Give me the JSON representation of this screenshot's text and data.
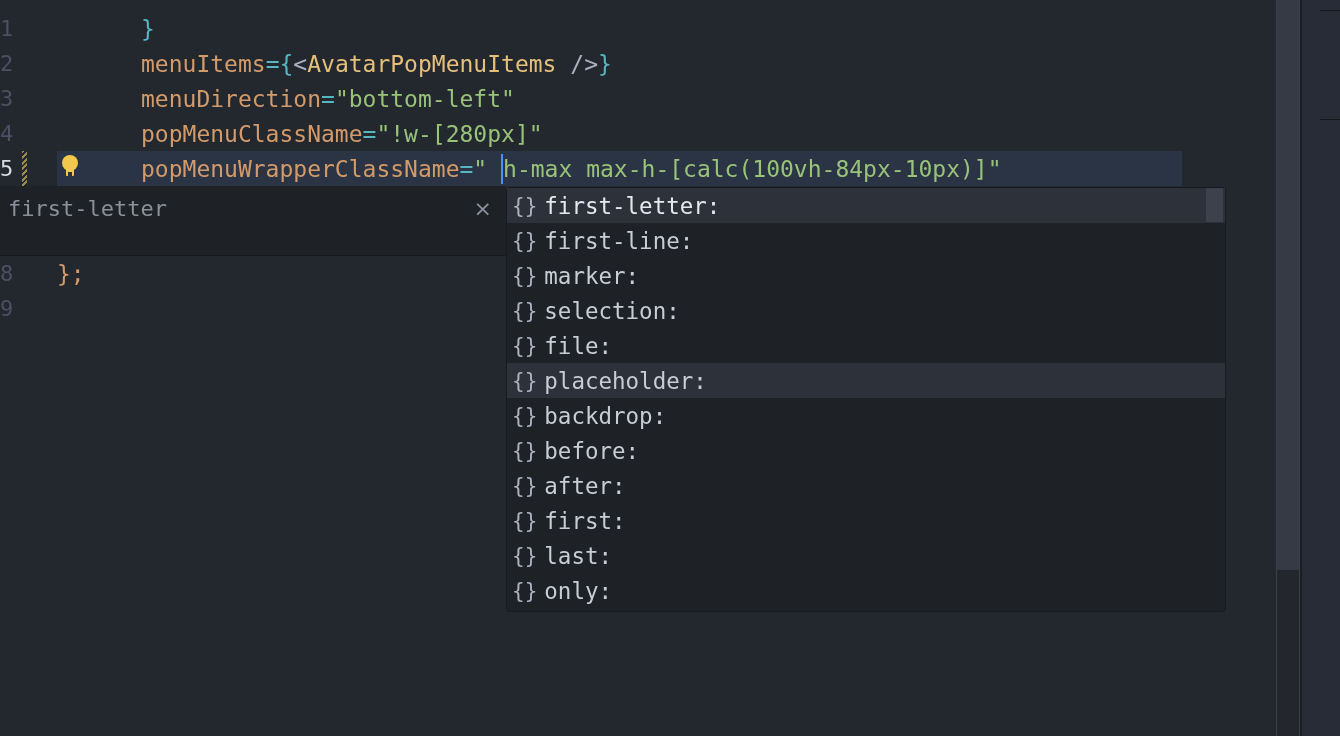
{
  "editor": {
    "lines": [
      {
        "number": "1",
        "current": false,
        "lightbulb": false,
        "modified": false,
        "indented": true,
        "tokens": [
          {
            "kind": "punct",
            "text": "}"
          }
        ]
      },
      {
        "number": "2",
        "current": false,
        "lightbulb": false,
        "modified": false,
        "indented": true,
        "tokens": [
          {
            "kind": "attr",
            "text": "menuItems"
          },
          {
            "kind": "punct",
            "text": "={"
          },
          {
            "kind": "plain",
            "text": "<"
          },
          {
            "kind": "tag",
            "text": "AvatarPopMenuItems"
          },
          {
            "kind": "plain",
            "text": " />"
          },
          {
            "kind": "punct",
            "text": "}"
          }
        ]
      },
      {
        "number": "3",
        "current": false,
        "lightbulb": false,
        "modified": false,
        "indented": true,
        "tokens": [
          {
            "kind": "attr",
            "text": "menuDirection"
          },
          {
            "kind": "punct",
            "text": "="
          },
          {
            "kind": "string",
            "text": "\"bottom-left\""
          }
        ]
      },
      {
        "number": "4",
        "current": false,
        "lightbulb": false,
        "modified": false,
        "indented": true,
        "tokens": [
          {
            "kind": "attr",
            "text": "popMenuClassName"
          },
          {
            "kind": "punct",
            "text": "="
          },
          {
            "kind": "string",
            "text": "\"!w-[280px]\""
          }
        ]
      },
      {
        "number": "5",
        "current": true,
        "lightbulb": true,
        "modified": true,
        "indented": true,
        "tokens": [
          {
            "kind": "attr",
            "text": "popMenuWrapperClassName"
          },
          {
            "kind": "punct",
            "text": "="
          },
          {
            "kind": "string",
            "text": "\" "
          },
          {
            "kind": "cursor"
          },
          {
            "kind": "string",
            "text": "h-max max-h-[calc(100vh-84px-10px)]\""
          }
        ]
      }
    ],
    "detail_panel": {
      "label": "first-letter",
      "close": "×"
    },
    "lines_below": [
      {
        "number": "8",
        "current": false,
        "lightbulb": false,
        "modified": false,
        "indented": false,
        "tokens": [
          {
            "kind": "attr",
            "text": "};"
          }
        ]
      },
      {
        "number": "9",
        "current": false,
        "lightbulb": false,
        "modified": false,
        "indented": false
      }
    ]
  },
  "suggestions": [
    {
      "icon": "{}",
      "label": "first-letter:",
      "selected": true,
      "hovered": false
    },
    {
      "icon": "{}",
      "label": "first-line:",
      "selected": false,
      "hovered": false
    },
    {
      "icon": "{}",
      "label": "marker:",
      "selected": false,
      "hovered": false
    },
    {
      "icon": "{}",
      "label": "selection:",
      "selected": false,
      "hovered": false
    },
    {
      "icon": "{}",
      "label": "file:",
      "selected": false,
      "hovered": false
    },
    {
      "icon": "{}",
      "label": "placeholder:",
      "selected": false,
      "hovered": true
    },
    {
      "icon": "{}",
      "label": "backdrop:",
      "selected": false,
      "hovered": false
    },
    {
      "icon": "{}",
      "label": "before:",
      "selected": false,
      "hovered": false
    },
    {
      "icon": "{}",
      "label": "after:",
      "selected": false,
      "hovered": false
    },
    {
      "icon": "{}",
      "label": "first:",
      "selected": false,
      "hovered": false
    },
    {
      "icon": "{}",
      "label": "last:",
      "selected": false,
      "hovered": false
    },
    {
      "icon": "{}",
      "label": "only:",
      "selected": false,
      "hovered": false
    }
  ]
}
